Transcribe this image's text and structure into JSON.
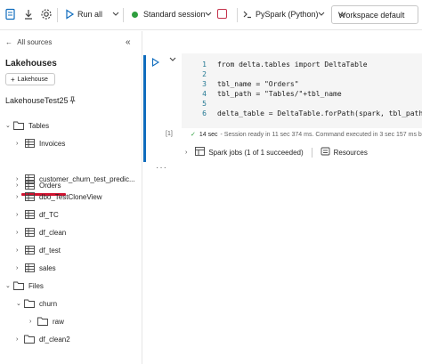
{
  "toolbar": {
    "run_all_label": "Run all",
    "session_label": "Standard session",
    "language_label": "PySpark (Python)",
    "environment_label": "Workspace default"
  },
  "sidebar": {
    "back_label": "All sources",
    "section_title": "Lakehouses",
    "add_button_label": "Lakehouse",
    "lakehouse_name": "LakehouseTest25",
    "tables_label": "Tables",
    "tables": [
      "Invoices",
      "Orders",
      "customer_churn_test_predic...",
      "dbo_TestCloneView",
      "df_TC",
      "df_clean",
      "df_test",
      "sales"
    ],
    "files_label": "Files",
    "folders": [
      "churn",
      "raw",
      "df_clean2"
    ]
  },
  "cell": {
    "line_numbers": [
      "1",
      "2",
      "3",
      "4",
      "5",
      "6"
    ],
    "code_lines": [
      "from delta.tables import DeltaTable",
      "",
      "tbl_name = \"Orders\"",
      "tbl_path = \"Tables/\"+tbl_name",
      "",
      "delta_table = DeltaTable.forPath(spark, tbl_path)"
    ],
    "execution_count": "[1]",
    "status_time": "14 sec",
    "status_message": "- Session ready in 11 sec 374 ms. Command executed in 3 sec 157 ms b",
    "spark_jobs_label": "Spark jobs (1 of 1 succeeded)",
    "resources_label": "Resources"
  },
  "colors": {
    "accent": "#0f6cbd",
    "success": "#2e9e3e",
    "highlight": "#d1112f"
  }
}
